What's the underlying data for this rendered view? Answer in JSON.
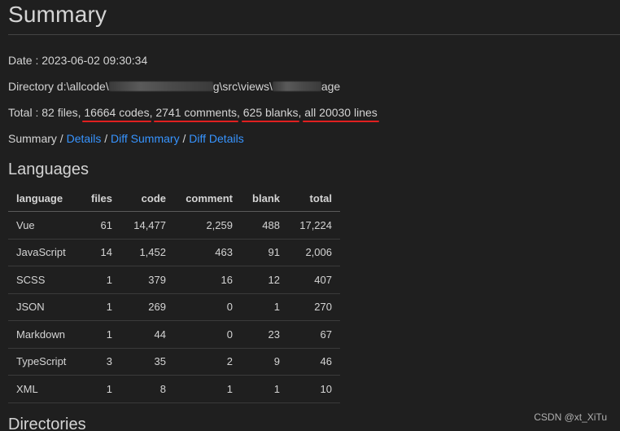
{
  "header": {
    "title": "Summary"
  },
  "info": {
    "date_label": "Date : ",
    "date_value": "2023-06-02 09:30:34",
    "dir_label": "Directory ",
    "dir_part1": "d:\\allcode\\",
    "dir_part2": "g\\src\\views\\",
    "dir_part3": "age",
    "total_prefix": "Total : 82 files, ",
    "codes": "16664 codes",
    "comments": "2741 comments",
    "blanks": "625 blanks",
    "all_prefix": "all ",
    "all_lines": "20030 lines"
  },
  "nav": {
    "summary": "Summary",
    "sep": " / ",
    "details": "Details",
    "diff_summary": "Diff Summary",
    "diff_details": "Diff Details"
  },
  "languages": {
    "heading": "Languages",
    "columns": [
      "language",
      "files",
      "code",
      "comment",
      "blank",
      "total"
    ],
    "rows": [
      [
        "Vue",
        "61",
        "14,477",
        "2,259",
        "488",
        "17,224"
      ],
      [
        "JavaScript",
        "14",
        "1,452",
        "463",
        "91",
        "2,006"
      ],
      [
        "SCSS",
        "1",
        "379",
        "16",
        "12",
        "407"
      ],
      [
        "JSON",
        "1",
        "269",
        "0",
        "1",
        "270"
      ],
      [
        "Markdown",
        "1",
        "44",
        "0",
        "23",
        "67"
      ],
      [
        "TypeScript",
        "3",
        "35",
        "2",
        "9",
        "46"
      ],
      [
        "XML",
        "1",
        "8",
        "1",
        "1",
        "10"
      ]
    ]
  },
  "directories": {
    "heading": "Directories"
  },
  "watermark": "CSDN @xt_XiTu"
}
